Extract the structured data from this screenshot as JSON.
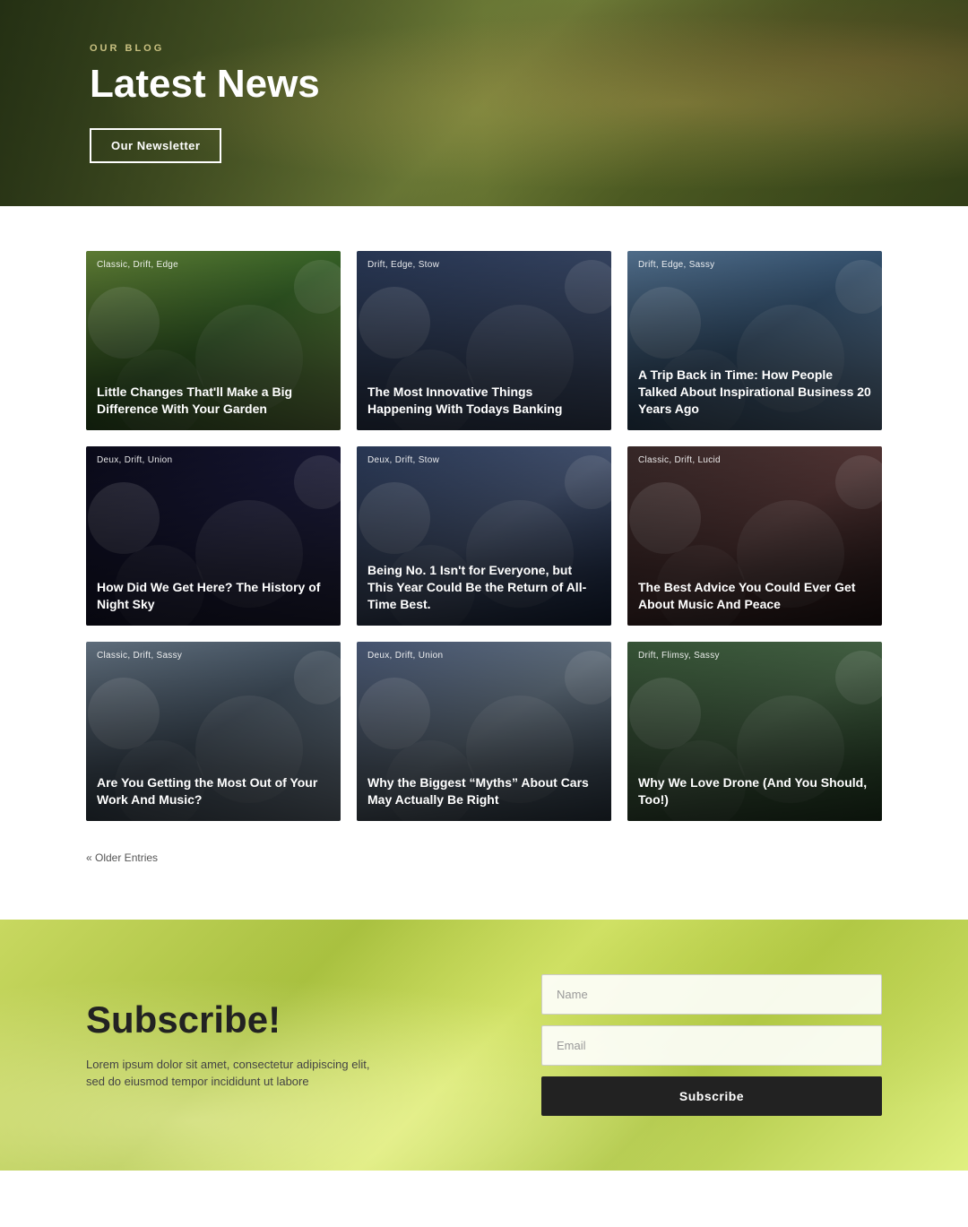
{
  "hero": {
    "label": "OUR BLOG",
    "title": "Latest News",
    "newsletter_btn": "Our Newsletter"
  },
  "blog": {
    "cards": [
      {
        "id": "garden",
        "tags": "Classic, Drift, Edge",
        "title": "Little Changes That'll Make a Big Difference With Your Garden",
        "color_class": "card-garden"
      },
      {
        "id": "banking",
        "tags": "Drift, Edge, Stow",
        "title": "The Most Innovative Things Happening With Todays Banking",
        "color_class": "card-banking"
      },
      {
        "id": "business",
        "tags": "Drift, Edge, Sassy",
        "title": "A Trip Back in Time: How People Talked About Inspirational Business 20 Years Ago",
        "color_class": "card-business"
      },
      {
        "id": "nightsky",
        "tags": "Deux, Drift, Union",
        "title": "How Did We Get Here? The History of Night Sky",
        "color_class": "card-nightsky"
      },
      {
        "id": "best",
        "tags": "Deux, Drift, Stow",
        "title": "Being No. 1 Isn't for Everyone, but This Year Could Be the Return of All-Time Best.",
        "color_class": "card-best"
      },
      {
        "id": "music",
        "tags": "Classic, Drift, Lucid",
        "title": "The Best Advice You Could Ever Get About Music And Peace",
        "color_class": "card-music"
      },
      {
        "id": "workmusic",
        "tags": "Classic, Drift, Sassy",
        "title": "Are You Getting the Most Out of Your Work And Music?",
        "color_class": "card-workmusic"
      },
      {
        "id": "cars",
        "tags": "Deux, Drift, Union",
        "title": "Why the Biggest “Myths” About Cars May Actually Be Right",
        "color_class": "card-cars"
      },
      {
        "id": "drone",
        "tags": "Drift, Flimsy, Sassy",
        "title": "Why We Love Drone (And You Should, Too!)",
        "color_class": "card-drone"
      }
    ],
    "pagination": {
      "older_entries": "« Older Entries"
    }
  },
  "subscribe": {
    "title": "Subscribe!",
    "description": "Lorem ipsum dolor sit amet, consectetur adipiscing elit, sed do eiusmod tempor incididunt ut labore",
    "name_placeholder": "Name",
    "email_placeholder": "Email",
    "btn_label": "Subscribe"
  }
}
